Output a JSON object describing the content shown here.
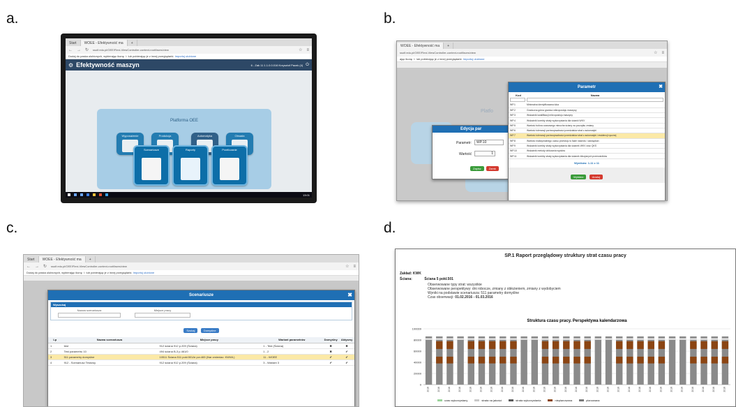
{
  "labels": {
    "a": "a.",
    "b": "b.",
    "c": "c.",
    "d": "d."
  },
  "browser": {
    "tab_start": "Start",
    "tab_app": "WOEE - Efektywność ma",
    "url_short": "ssolf.edu.pl/OEE/Flexi-ViewController-context-root/faces/view",
    "fav_text": "Dodaj do paska ulubionych, wybierając ikonę ☆ lub pobierając je z innej przeglądarki.",
    "fav_link": "Importuj ulubione"
  },
  "panel_a": {
    "app_title": "Efektywność maszyn",
    "user_info": "6 - Zak 11  1.1.0.0.016  Krzysztof Pacek (4)",
    "platform_title": "Platforma OEE",
    "tiles_small": [
      "Wyposażenie",
      "Produkcja",
      "Automatyka",
      "Obsada"
    ],
    "tiles_large": [
      "Scenariusze",
      "Raporty",
      "Przeliczanie"
    ],
    "clock": "13:01"
  },
  "panel_b": {
    "url": "ssolf.edu.pl/OEE/Flexi-ViewController-context-root/faces/view",
    "fav_text": "ając ikonę ☆ lub pobierając je z innej przeglądarki.",
    "fav_link": "Importuj ulubione",
    "bg_text": "Platfo",
    "param_dialog": {
      "title": "Parametr",
      "col_id": "Kod",
      "col_name": "Nazwa",
      "rows": [
        {
          "id": "WP.1",
          "name": "Minimalna identyfikowana luka"
        },
        {
          "id": "WP.2",
          "name": "Graniczna górna granica mikropostoju maszyny"
        },
        {
          "id": "WP.3",
          "name": "Wskaźnik kwalifikacji mikropostoju maszyny"
        },
        {
          "id": "WP.4",
          "name": "Wskaźnik korekty straty wykorzystania dla ścianki WKV"
        },
        {
          "id": "WP.5",
          "name": "Wartość bufora czasowego minucha ściany na początku zmiany"
        },
        {
          "id": "WP.6",
          "name": "Wartość tolerancji porównywalności przedziałów strat z automatyki"
        },
        {
          "id": "WP.7",
          "name": "Wartość tolerancji porównywalności przedziałów strat z automatyki i ewidencji ręcznej"
        },
        {
          "id": "WP.8",
          "name": "Wartość maksymalnego czasu przestoju w fazie nawrotu i zawiązkan"
        },
        {
          "id": "WP.9",
          "name": "Wskaźnik korekty straty wykorzystania dla ścianek WKV oraz QKS"
        },
        {
          "id": "WP.10",
          "name": "Wskaźnik metody obliczania wydobu"
        },
        {
          "id": "WP.11",
          "name": "Wskaźnik korekty straty wykorzystania dla ścianek łóbzysnych przenośników"
        }
      ],
      "highlight_index": 6,
      "result": "Wyników: 1-11 z 11",
      "btn_select": "Wybierz",
      "btn_cancel": "Anuluj"
    },
    "edit_dialog": {
      "title": "Edycja par",
      "label_param": "Parametr:",
      "param_value": "WP.10",
      "label_value": "Wartość",
      "value": "1",
      "btn_save": "Zapisz",
      "btn_cancel": "Zamk"
    }
  },
  "panel_c": {
    "dialog_title": "Scenariusze",
    "search_section": "Wyszukaj",
    "label_name": "Nazwa scenariusza",
    "label_place": "Miejsce pracy",
    "btn_search": "Szukaj",
    "btn_clear": "Domyślne",
    "columns": [
      "Lp",
      "Nazwa scenariusza",
      "Miejsce pracy",
      "Wariant parametrów",
      "Domyślny",
      "Aktywny"
    ],
    "rows": [
      {
        "lp": "1",
        "name": "test",
        "place": "912 ściana 912 p.209 (Ściana)",
        "variant": "1 - Test (Ściana)",
        "def": "✖",
        "act": "✖"
      },
      {
        "lp": "2",
        "name": "Test parametru 10",
        "place": "494 ściana B-3 p.461/0",
        "variant": "1 - 2",
        "def": "✖",
        "act": "✔"
      },
      {
        "lp": "3",
        "name": "511 parametry domyślne",
        "place": "10511 Ściana 511 pokł.501Ar pcr.465 (Nar zmieniac: KWWL)",
        "variant": "11 - WOEE",
        "def": "✔",
        "act": "✔"
      },
      {
        "lp": "4",
        "name": "912 - Scenariusz Testowy",
        "place": "912 ściana 912 p.209 (Ściana)",
        "variant": "3 - Wariant 3",
        "def": "✔",
        "act": "✔"
      }
    ],
    "highlight_index": 2
  },
  "panel_d": {
    "title": "SP.1 Raport przeglądowy struktury strat czasu pracy",
    "zaklad_label": "Zakład:",
    "zaklad_value": "KWK",
    "sciana_label": "Ściana:",
    "sciana_value": "Ściana 5    pokł.501",
    "info_lines": [
      "Obserwowane typy strat: wszystkie",
      "Obserwowane perspektywy: dni robocze, zmiany z obłożeniem, zmiany z wydobyciem",
      "Wyniki na podstawie scenariusza: 511 parametry domyślne"
    ],
    "period_label": "Czas obserwacji:",
    "period_value": "01.02.2016 - 01.03.2016",
    "legend": [
      "czas wykorzystany",
      "strata na jakości",
      "strata wykorzystania",
      "nieplanowana",
      "planowana"
    ],
    "legend_line2": [
      "wykorzystaniowy",
      "niedostępność",
      "niedostępność"
    ],
    "colors": {
      "green": "#9bd49b",
      "gray_light": "#c9c9c9",
      "gray_dark": "#5a5a5a",
      "brown": "#8b4513",
      "gray_mid": "#7a7a7a"
    }
  },
  "chart_data": {
    "type": "bar",
    "title": "Struktura czasu pracy. Perspektywa kalendarzowa",
    "ylim": [
      0,
      100000
    ],
    "yticks": [
      0,
      20000,
      40000,
      60000,
      80000,
      100000
    ],
    "stacked": true,
    "n_bars": 29,
    "x_tick_labels": [
      "2016",
      "2016",
      "2016",
      "2016",
      "2016",
      "2016",
      "2016",
      "2016",
      "2016",
      "2016",
      "2016",
      "2016",
      "2016",
      "2016",
      "2016",
      "2016",
      "2016",
      "2016",
      "2016",
      "2016",
      "2016",
      "2016",
      "2016",
      "2016",
      "2016",
      "2016",
      "2016",
      "2016",
      "2016"
    ],
    "bars": [
      {
        "total": 86400,
        "brown": false
      },
      {
        "total": 86400,
        "brown": true
      },
      {
        "total": 86400,
        "brown": true
      },
      {
        "total": 86400,
        "brown": false
      },
      {
        "total": 86400,
        "brown": true
      },
      {
        "total": 86400,
        "brown": true
      },
      {
        "total": 86400,
        "brown": true
      },
      {
        "total": 86400,
        "brown": true
      },
      {
        "total": 86400,
        "brown": true
      },
      {
        "total": 86400,
        "brown": false
      },
      {
        "total": 86400,
        "brown": false
      },
      {
        "total": 86400,
        "brown": true
      },
      {
        "total": 86400,
        "brown": true
      },
      {
        "total": 86400,
        "brown": true
      },
      {
        "total": 86400,
        "brown": true
      },
      {
        "total": 86400,
        "brown": true
      },
      {
        "total": 86400,
        "brown": false
      },
      {
        "total": 86400,
        "brown": false
      },
      {
        "total": 86400,
        "brown": true
      },
      {
        "total": 86400,
        "brown": true
      },
      {
        "total": 86400,
        "brown": true
      },
      {
        "total": 86400,
        "brown": true
      },
      {
        "total": 86400,
        "brown": true
      },
      {
        "total": 86400,
        "brown": false
      },
      {
        "total": 86400,
        "brown": false
      },
      {
        "total": 86400,
        "brown": true
      },
      {
        "total": 86400,
        "brown": true
      },
      {
        "total": 86400,
        "brown": true
      },
      {
        "total": 86400,
        "brown": true
      }
    ]
  }
}
